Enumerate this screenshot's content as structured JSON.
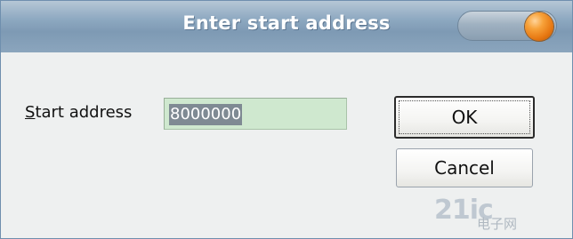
{
  "window": {
    "title": "Enter start address",
    "close_icon": "close-icon"
  },
  "form": {
    "label_prefix": "S",
    "label_rest": "tart address",
    "start_address_value": "8000000"
  },
  "buttons": {
    "ok_label": "OK",
    "cancel_label": "Cancel"
  },
  "watermark": {
    "main": "21ic",
    "sub": "电子网"
  },
  "colors": {
    "titlebar": "#8ea9c1",
    "close_button": "#f7a23a",
    "field_background": "#cfe8cf",
    "selection": "#7f8a93"
  }
}
